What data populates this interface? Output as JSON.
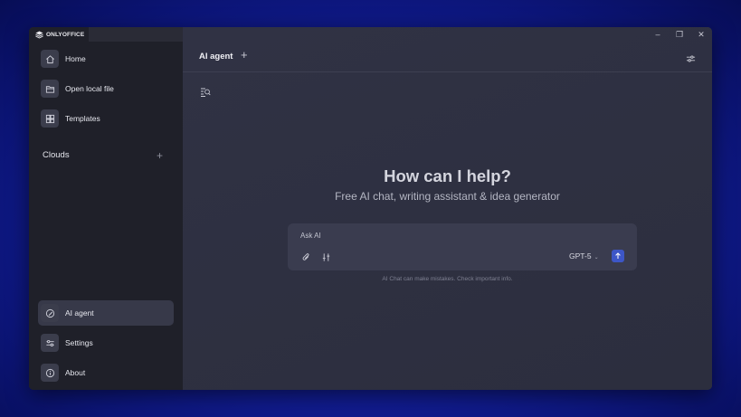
{
  "app": {
    "name": "ONLYOFFICE"
  },
  "window_controls": {
    "minimize": "–",
    "restore": "❐",
    "close": "✕"
  },
  "sidebar": {
    "items_top": [
      {
        "label": "Home",
        "icon": "home-icon"
      },
      {
        "label": "Open local file",
        "icon": "folder-icon"
      },
      {
        "label": "Templates",
        "icon": "templates-icon"
      }
    ],
    "clouds_label": "Clouds",
    "clouds_add": "+",
    "items_bottom": [
      {
        "label": "AI agent",
        "icon": "ai-edit-icon",
        "active": true
      },
      {
        "label": "Settings",
        "icon": "sliders-icon"
      },
      {
        "label": "About",
        "icon": "info-icon"
      }
    ]
  },
  "header": {
    "tab_title": "AI agent",
    "add_tab": "+"
  },
  "hero": {
    "title": "How can I help?",
    "subtitle": "Free AI chat, writing assistant & idea generator"
  },
  "chat": {
    "placeholder": "Ask AI",
    "model": "GPT-5",
    "disclaimer": "AI Chat can make mistakes. Check important info."
  },
  "colors": {
    "accent": "#3d56c7",
    "sidebar_bg": "#1f2029",
    "main_bg": "#2e3041",
    "desktop_bg": "#1420a0"
  }
}
